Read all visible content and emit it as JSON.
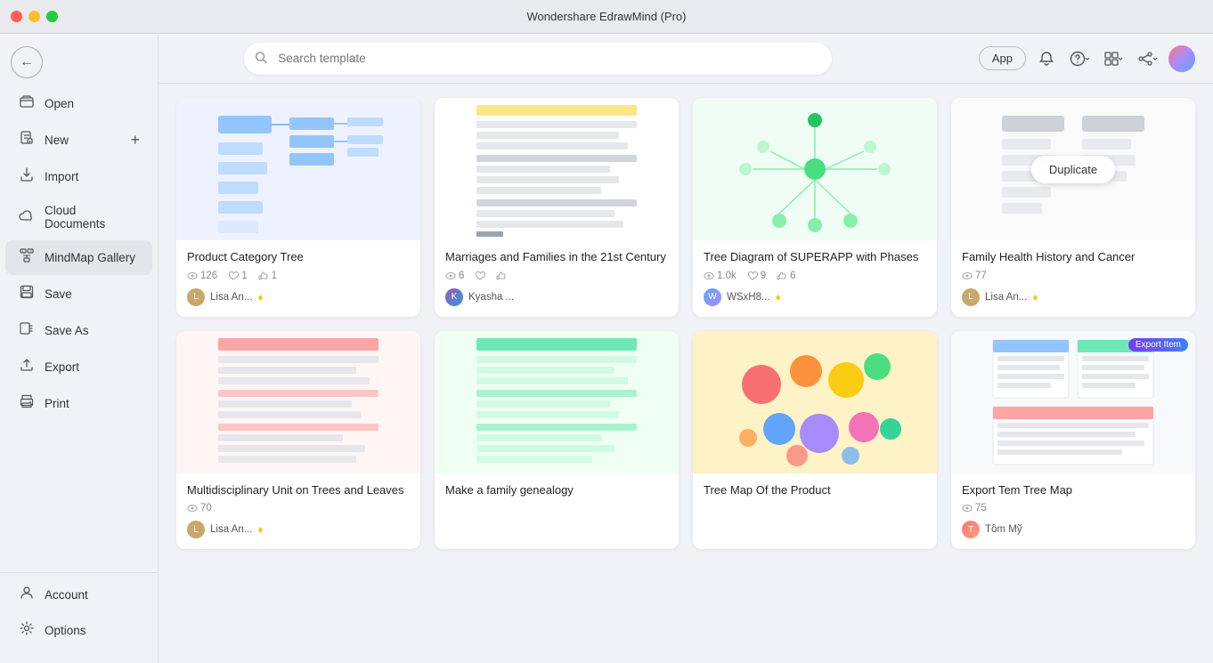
{
  "app": {
    "title": "Wondershare EdrawMind (Pro)"
  },
  "sidebar": {
    "back_label": "←",
    "items": [
      {
        "id": "open",
        "label": "Open",
        "icon": "📂"
      },
      {
        "id": "new",
        "label": "New",
        "icon": "📄",
        "has_plus": true
      },
      {
        "id": "import",
        "label": "Import",
        "icon": "📥"
      },
      {
        "id": "cloud",
        "label": "Cloud Documents",
        "icon": "☁️"
      },
      {
        "id": "mindmap",
        "label": "MindMap Gallery",
        "icon": "🗺️",
        "active": true
      },
      {
        "id": "save",
        "label": "Save",
        "icon": "💾"
      },
      {
        "id": "saveas",
        "label": "Save As",
        "icon": "🗂️"
      },
      {
        "id": "export",
        "label": "Export",
        "icon": "📤"
      },
      {
        "id": "print",
        "label": "Print",
        "icon": "🖨️"
      }
    ],
    "bottom_items": [
      {
        "id": "account",
        "label": "Account",
        "icon": "👤"
      },
      {
        "id": "options",
        "label": "Options",
        "icon": "⚙️"
      }
    ]
  },
  "topbar": {
    "app_btn": "App",
    "search_placeholder": "Search template"
  },
  "cards": [
    {
      "id": "product-category-tree",
      "title": "Product Category Tree",
      "views": "126",
      "likes": "1",
      "thumbs": "1",
      "author": "Lisa An...",
      "author_type": "premium",
      "thumb_type": "tree-blue",
      "thumb_bg": "#f0f4ff"
    },
    {
      "id": "marriages-families",
      "title": "Marriages and Families in the 21st Century",
      "views": "6",
      "likes": "",
      "thumbs": "",
      "author": "Kyasha ...",
      "author_type": "normal",
      "thumb_type": "text-doc",
      "thumb_bg": "#fff"
    },
    {
      "id": "tree-diagram-superapp",
      "title": "Tree Diagram of SUPERAPP with Phases",
      "views": "1.0k",
      "likes": "9",
      "thumbs": "6",
      "author": "WSxH8...",
      "author_type": "premium",
      "thumb_type": "tree-green",
      "thumb_bg": "#f0fff4"
    },
    {
      "id": "family-health-history",
      "title": "Family Health History and Cancer",
      "views": "77",
      "likes": "",
      "thumbs": "",
      "author": "Lisa An...",
      "author_type": "premium",
      "thumb_type": "tree-gray",
      "thumb_bg": "#f5f5f5",
      "has_duplicate": true
    },
    {
      "id": "multidisciplinary-trees",
      "title": "Multidisciplinary Unit on Trees and Leaves",
      "views": "70",
      "likes": "",
      "thumbs": "",
      "author": "Lisa An...",
      "author_type": "premium",
      "thumb_type": "text-pink",
      "thumb_bg": "#fff5f5"
    },
    {
      "id": "make-family-genealogy",
      "title": "Make a family genealogy",
      "views": "",
      "likes": "",
      "thumbs": "",
      "author": "",
      "author_type": "normal",
      "thumb_type": "text-green",
      "thumb_bg": "#f0fff4"
    },
    {
      "id": "tree-map-product",
      "title": "Tree Map Of the Product",
      "views": "",
      "likes": "",
      "thumbs": "",
      "author": "",
      "author_type": "normal",
      "thumb_type": "tree-pink",
      "thumb_bg": "#fff0f5"
    },
    {
      "id": "export-tem-tree-map",
      "title": "Export Tem Tree Map",
      "views": "75",
      "likes": "",
      "thumbs": "",
      "author": "Tôm Mỹ",
      "author_type": "normal",
      "thumb_type": "export-table",
      "thumb_bg": "#f8f9fa",
      "has_export_badge": true
    }
  ],
  "duplicate_btn": "Duplicate",
  "export_badge": "Export Item"
}
